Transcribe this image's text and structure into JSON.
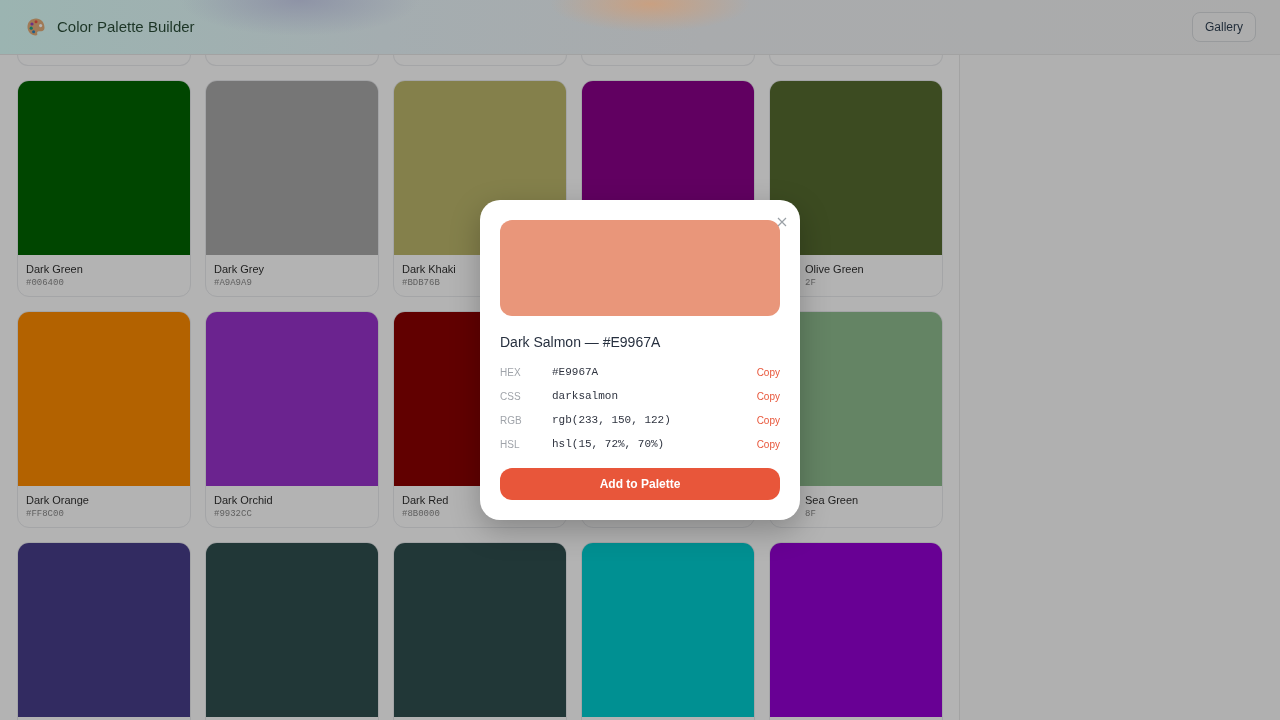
{
  "header": {
    "title": "Color Palette Builder",
    "button": "Gallery"
  },
  "cards": [
    {
      "kind": "plain",
      "name": "Dark Green",
      "hex": "#006400",
      "color": "#004600"
    },
    {
      "kind": "plain",
      "name": "Dark Grey",
      "hex": "#A9A9A9",
      "color": "#767676"
    },
    {
      "kind": "plain",
      "name": "Dark Khaki",
      "hex": "#BDB76B",
      "color": "#84804b"
    },
    {
      "kind": "unlabeled",
      "color": "#610061"
    },
    {
      "kind": "clipped",
      "name": "Olive Green",
      "hex": "2F",
      "color": "#3c4b21"
    },
    {
      "kind": "plain",
      "name": "Dark Orange",
      "hex": "#FF8C00",
      "color": "#b36200"
    },
    {
      "kind": "plain",
      "name": "Dark Orchid",
      "hex": "#9932CC",
      "color": "#6b238f"
    },
    {
      "kind": "plain",
      "name": "Dark Red",
      "hex": "#8B0000",
      "color": "#610000"
    },
    {
      "kind": "hidden"
    },
    {
      "kind": "clipped",
      "name": "Sea Green",
      "hex": "8F",
      "color": "#648464"
    },
    {
      "kind": "cropped",
      "color": "#322b61"
    },
    {
      "kind": "cropped",
      "color": "#213737"
    },
    {
      "kind": "cropped",
      "color": "#213737"
    },
    {
      "kind": "cropped",
      "color": "#009092"
    },
    {
      "kind": "cropped",
      "color": "#680094"
    }
  ],
  "dialog": {
    "color": "#e9967a",
    "title": "Dark Salmon — #E9967A",
    "rows": [
      {
        "label": "HEX",
        "value": "#E9967A",
        "action": "Copy"
      },
      {
        "label": "CSS",
        "value": "darksalmon",
        "action": "Copy"
      },
      {
        "label": "RGB",
        "value": "rgb(233, 150, 122)",
        "action": "Copy"
      },
      {
        "label": "HSL",
        "value": "hsl(15, 72%, 70%)",
        "action": "Copy"
      }
    ],
    "button": "Add to Palette"
  }
}
